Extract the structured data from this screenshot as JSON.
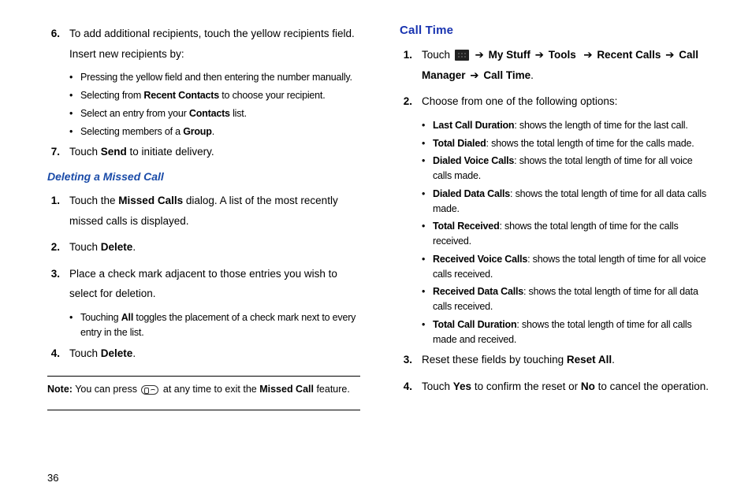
{
  "pageNumber": "36",
  "left": {
    "step6": {
      "num": "6.",
      "text_a": "To add additional recipients, touch the yellow recipients field. Insert new recipients by:",
      "bullets": [
        {
          "pre": "Pressing the yellow field and then entering the number manually."
        },
        {
          "pre": "Selecting from ",
          "bold": "Recent Contacts",
          "post": " to choose your recipient."
        },
        {
          "pre": "Select an entry from your ",
          "bold": "Contacts",
          "post": " list."
        },
        {
          "pre": "Selecting members of a ",
          "bold": "Group",
          "post": "."
        }
      ]
    },
    "step7": {
      "num": "7.",
      "pre": "Touch ",
      "bold": "Send",
      "post": " to initiate delivery."
    },
    "heading_delete": "Deleting a Missed Call",
    "del1": {
      "num": "1.",
      "pre": "Touch the ",
      "bold": "Missed Calls",
      "post": " dialog. A list of the most recently missed calls is displayed."
    },
    "del2": {
      "num": "2.",
      "pre": "Touch ",
      "bold": "Delete",
      "post": "."
    },
    "del3": {
      "num": "3.",
      "text": "Place a check mark adjacent to those entries you wish to select for deletion.",
      "sub": {
        "pre": "Touching ",
        "bold": "All",
        "post": " toggles the placement of a check mark next to every entry in the list."
      }
    },
    "del4": {
      "num": "4.",
      "pre": "Touch ",
      "bold": "Delete",
      "post": "."
    },
    "note": {
      "lead": "Note:",
      "pre": " You can press ",
      "post": " at any time to exit the ",
      "bold": "Missed Call",
      "end": " feature."
    }
  },
  "right": {
    "heading": "Call Time",
    "s1": {
      "num": "1.",
      "pre": "Touch ",
      "path": [
        "My Stuff",
        "Tools",
        "Recent Calls",
        "Call Manager",
        "Call Time"
      ],
      "arrow": "➔"
    },
    "s2": {
      "num": "2.",
      "text": "Choose from one of the following options:",
      "bullets": [
        {
          "bold": "Last Call Duration",
          "post": ": shows the length of time for the last call."
        },
        {
          "bold": "Total Dialed",
          "post": ": shows the total length of time for the calls made."
        },
        {
          "bold": "Dialed Voice Calls",
          "post": ": shows the total length of time for all voice calls made."
        },
        {
          "bold": "Dialed Data Calls",
          "post": ": shows the total length of time for all data calls made."
        },
        {
          "bold": "Total Received",
          "post": ": shows the total length of time for the calls received."
        },
        {
          "bold": "Received Voice Calls",
          "post": ": shows the total length of time for all voice calls received."
        },
        {
          "bold": "Received Data Calls",
          "post": ": shows the total length of time for all data calls received."
        },
        {
          "bold": "Total Call Duration",
          "post": ": shows the total length of time for all calls made and received."
        }
      ]
    },
    "s3": {
      "num": "3.",
      "pre": "Reset these fields by touching ",
      "bold": "Reset All",
      "post": "."
    },
    "s4": {
      "num": "4.",
      "pre": "Touch ",
      "bold1": "Yes",
      "mid": " to confirm the reset or ",
      "bold2": "No",
      "post": " to cancel the operation."
    }
  }
}
